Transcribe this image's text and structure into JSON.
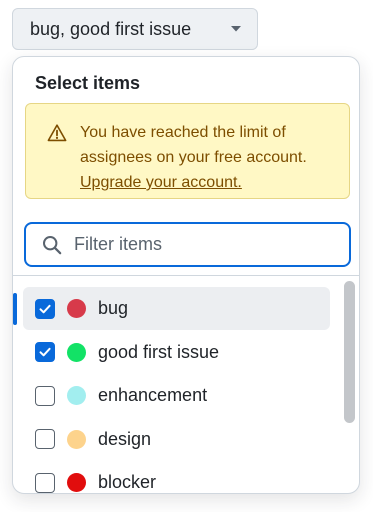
{
  "trigger": {
    "label": "bug, good first issue",
    "caret_icon": "triangle-down-icon"
  },
  "panel": {
    "title": "Select items",
    "banner": {
      "icon": "alert-icon",
      "message": "You have reached the limit of assignees on your free account.",
      "link_label": "Upgrade your account."
    },
    "filter": {
      "icon": "search-icon",
      "placeholder": "Filter items",
      "value": ""
    },
    "items": [
      {
        "label": "bug",
        "color": "#d73a4a",
        "checked": true,
        "active": true
      },
      {
        "label": "good first issue",
        "color": "#12e266",
        "checked": true,
        "active": false
      },
      {
        "label": "enhancement",
        "color": "#a2eeef",
        "checked": false,
        "active": false
      },
      {
        "label": "design",
        "color": "#fdd38c",
        "checked": false,
        "active": false
      },
      {
        "label": "blocker",
        "color": "#e10d0d",
        "checked": false,
        "active": false
      }
    ]
  },
  "colors": {
    "accent": "#0969da",
    "warning_bg": "#fff8c5",
    "warning_text": "#7d4e00"
  }
}
